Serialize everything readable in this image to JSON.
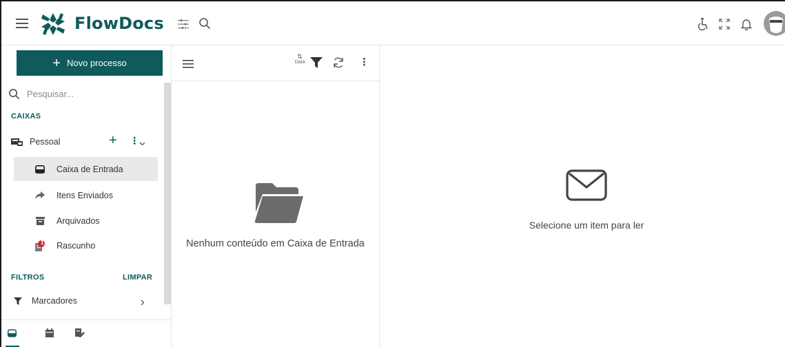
{
  "app": {
    "brand_name": "FlowDocs",
    "accent_color": "#0f5b5b"
  },
  "topbar": {
    "menu_icon": "hamburger-icon",
    "filters_icon": "sliders-icon",
    "search_icon": "search-icon",
    "right_icons": [
      "accessibility-icon",
      "fullscreen-icon",
      "bell-icon",
      "avatar"
    ]
  },
  "sidebar": {
    "new_process_label": "Novo processo",
    "search_placeholder": "Pesquisar...",
    "boxes_title": "CAIXAS",
    "box_name": "Pessoal",
    "items": [
      {
        "label": "Caixa de Entrada",
        "icon": "inbox-icon",
        "active": true
      },
      {
        "label": "Itens Enviados",
        "icon": "share-arrow-icon",
        "active": false
      },
      {
        "label": "Arquivados",
        "icon": "archive-icon",
        "active": false
      },
      {
        "label": "Rascunho",
        "icon": "draft-icon",
        "active": false,
        "badge": "1"
      }
    ],
    "filters_title": "FILTROS",
    "clear_label": "LIMPAR",
    "tags_label": "Marcadores"
  },
  "list": {
    "sort_label": "Data",
    "empty_message": "Nenhum conteúdo em Caixa de Entrada"
  },
  "reader": {
    "empty_message": "Selecione um item para ler"
  }
}
